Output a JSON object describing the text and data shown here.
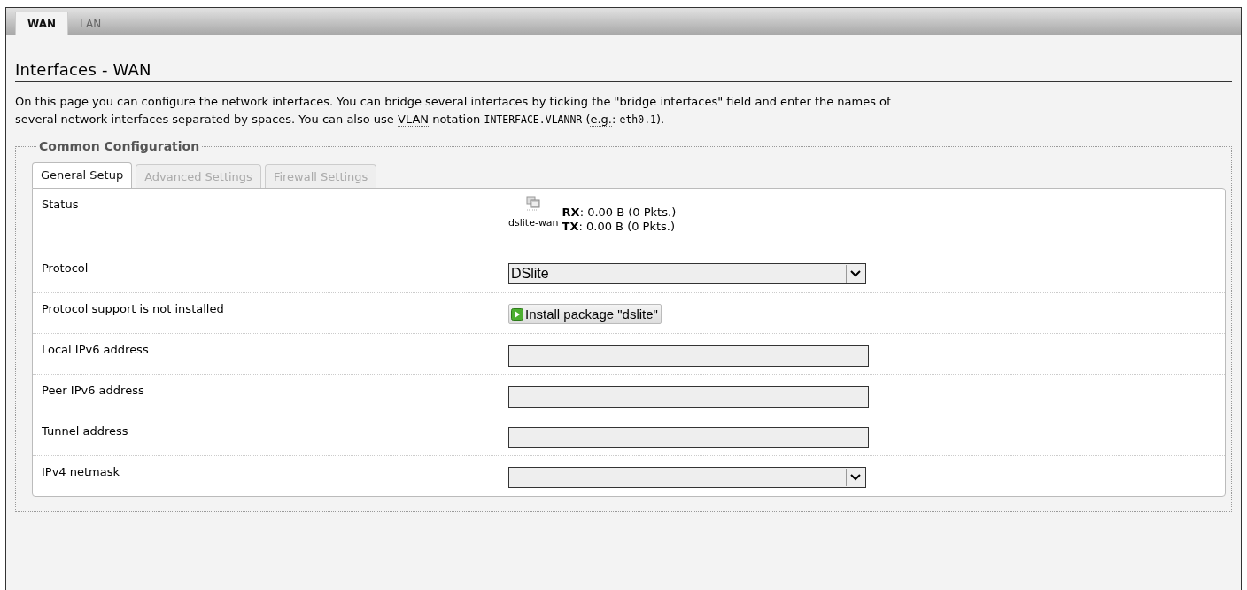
{
  "top_tabs": [
    {
      "label": "WAN",
      "selected": true
    },
    {
      "label": "LAN",
      "selected": false
    }
  ],
  "heading": "Interfaces - WAN",
  "description": [
    [
      {
        "kind": "text",
        "text": "On this page you can configure the network interfaces. You can bridge several interfaces by ticking the \"bridge interfaces\" field and enter the names of"
      }
    ],
    [
      {
        "kind": "text",
        "text": "several network interfaces separated by spaces. You can also use "
      },
      {
        "kind": "abbr",
        "text": "VLAN"
      },
      {
        "kind": "text",
        "text": " notation "
      },
      {
        "kind": "code",
        "text": "INTERFACE.VLANNR"
      },
      {
        "kind": "text",
        "text": " ("
      },
      {
        "kind": "abbr",
        "text": "e.g."
      },
      {
        "kind": "text",
        "text": ": "
      },
      {
        "kind": "code",
        "text": "eth0.1"
      },
      {
        "kind": "text",
        "text": ")."
      }
    ]
  ],
  "section": {
    "legend": "Common Configuration",
    "tabs": [
      {
        "label": "General Setup",
        "selected": true
      },
      {
        "label": "Advanced Settings",
        "selected": false
      },
      {
        "label": "Firewall Settings",
        "selected": false
      }
    ],
    "rows": [
      {
        "label": "Status",
        "kind": "status",
        "interface": "dslite-wan",
        "lines": [
          "**RX**: 0.00 B (0 Pkts.)",
          "**TX**: 0.00 B (0 Pkts.)"
        ]
      },
      {
        "label": "Protocol",
        "kind": "select",
        "value": "DSlite"
      },
      {
        "label": "Protocol support is not installed",
        "kind": "button",
        "button": "Install package \"dslite\""
      },
      {
        "label": "Local IPv6 address",
        "kind": "text"
      },
      {
        "label": "Peer IPv6 address",
        "kind": "text"
      },
      {
        "label": "Tunnel address",
        "kind": "text"
      },
      {
        "label": "IPv4 netmask",
        "kind": "select"
      }
    ]
  }
}
